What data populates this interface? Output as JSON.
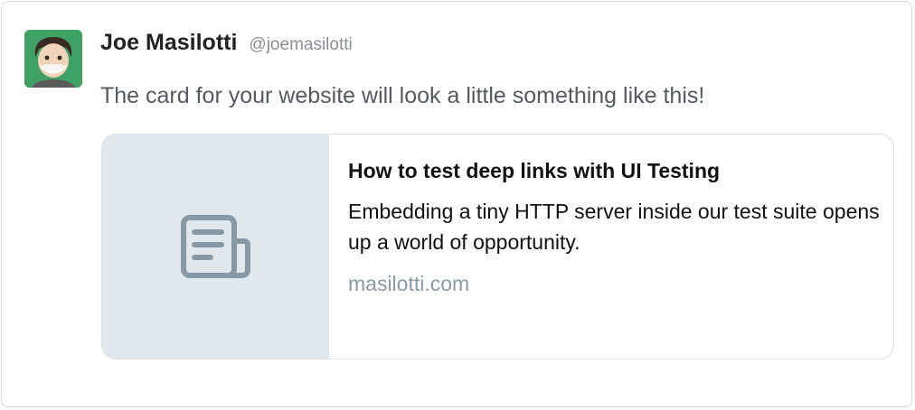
{
  "author": {
    "name": "Joe Masilotti",
    "handle": "@joemasilotti"
  },
  "tweet": {
    "text": "The card for your website will look a little something like this!"
  },
  "card": {
    "media_icon": "document-icon",
    "title": "How to test deep links with UI Testing",
    "description": "Embedding a tiny HTTP server inside our test suite opens up a world of opportunity.",
    "domain": "masilotti.com"
  },
  "colors": {
    "avatar_bg": "#3fa164",
    "media_bg": "#e1e8ed",
    "icon": "#8899a6",
    "domain": "#8a98a5"
  }
}
